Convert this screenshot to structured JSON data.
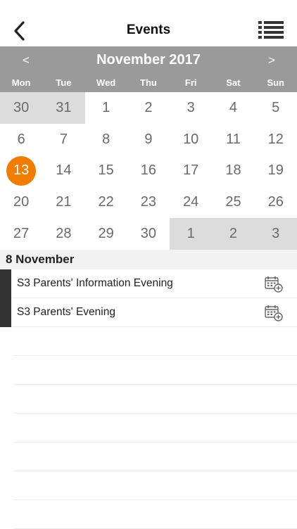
{
  "nav": {
    "title": "Events"
  },
  "calendar": {
    "month_label": "November 2017",
    "prev": "<",
    "next": ">",
    "weekdays": [
      "Mon",
      "Tue",
      "Wed",
      "Thu",
      "Fri",
      "Sat",
      "Sun"
    ],
    "weeks": [
      [
        {
          "d": "30",
          "other": true
        },
        {
          "d": "31",
          "other": true
        },
        {
          "d": "1"
        },
        {
          "d": "2"
        },
        {
          "d": "3"
        },
        {
          "d": "4"
        },
        {
          "d": "5"
        }
      ],
      [
        {
          "d": "6"
        },
        {
          "d": "7"
        },
        {
          "d": "8"
        },
        {
          "d": "9"
        },
        {
          "d": "10"
        },
        {
          "d": "11"
        },
        {
          "d": "12"
        }
      ],
      [
        {
          "d": "13",
          "selected": true
        },
        {
          "d": "14"
        },
        {
          "d": "15"
        },
        {
          "d": "16"
        },
        {
          "d": "17"
        },
        {
          "d": "18"
        },
        {
          "d": "19"
        }
      ],
      [
        {
          "d": "20"
        },
        {
          "d": "21"
        },
        {
          "d": "22"
        },
        {
          "d": "23"
        },
        {
          "d": "24"
        },
        {
          "d": "25"
        },
        {
          "d": "26"
        }
      ],
      [
        {
          "d": "27"
        },
        {
          "d": "28"
        },
        {
          "d": "29"
        },
        {
          "d": "30"
        },
        {
          "d": "1",
          "other": true
        },
        {
          "d": "2",
          "other": true
        },
        {
          "d": "3",
          "other": true
        }
      ]
    ],
    "selected_color": "#f07c00",
    "header_color": "#9a9a9a"
  },
  "day_section": {
    "date_label": "8 November"
  },
  "events": [
    {
      "title": "S3 Parents' Information Evening",
      "icon": "calendar-add-icon"
    },
    {
      "title": "S3 Parents' Evening",
      "icon": "calendar-add-icon"
    }
  ]
}
